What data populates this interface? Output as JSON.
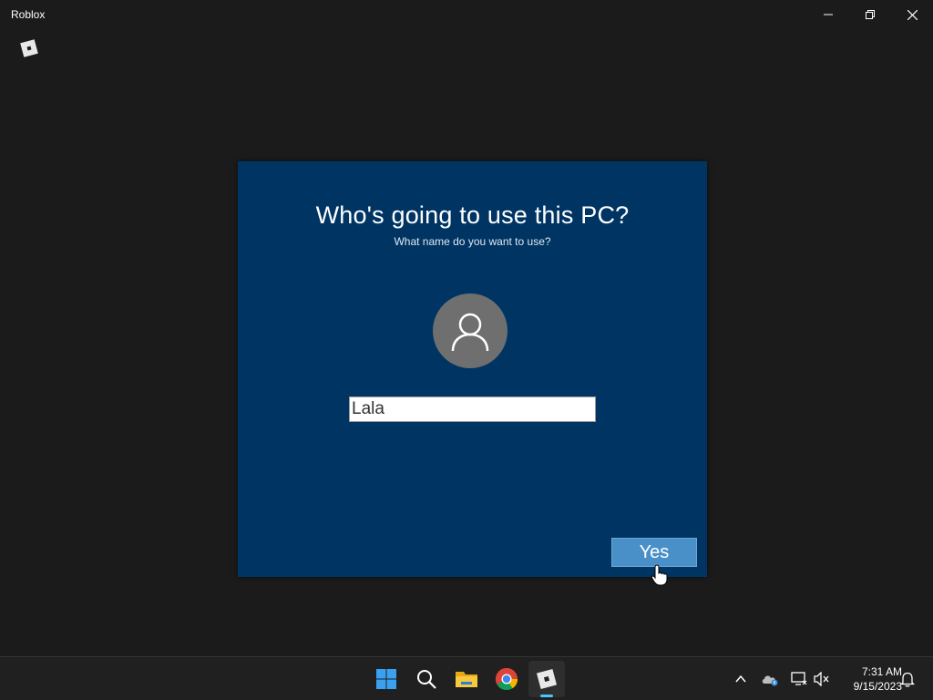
{
  "window": {
    "title": "Roblox",
    "icon": "roblox-logo-icon",
    "controls": [
      "minimize-icon",
      "maximize-icon",
      "close-icon"
    ]
  },
  "dialog": {
    "title": "Who's going to use this PC?",
    "subtitle": "What name do you want to use?",
    "avatar_icon": "user-icon",
    "name_input": {
      "value": "Lala",
      "placeholder": ""
    },
    "confirm_label": "Yes"
  },
  "taskbar": {
    "apps": [
      {
        "name": "start",
        "icon": "windows-logo-icon"
      },
      {
        "name": "search",
        "icon": "search-icon"
      },
      {
        "name": "file-explorer",
        "icon": "folder-icon"
      },
      {
        "name": "chrome",
        "icon": "chrome-icon"
      },
      {
        "name": "roblox",
        "icon": "roblox-logo-icon",
        "active": true
      }
    ],
    "tray": [
      "chevron-up-icon",
      "onedrive-icon",
      "network-icon",
      "volume-muted-icon"
    ],
    "time": "7:31 AM",
    "date": "9/15/2023",
    "notification_icon": "bell-icon"
  },
  "colors": {
    "background": "#1b1b1b",
    "dialog": "#003563",
    "button": "#4a90c8",
    "avatar": "#6f6f6f",
    "taskbar": "#202020",
    "accent": "#4cc2ff"
  }
}
